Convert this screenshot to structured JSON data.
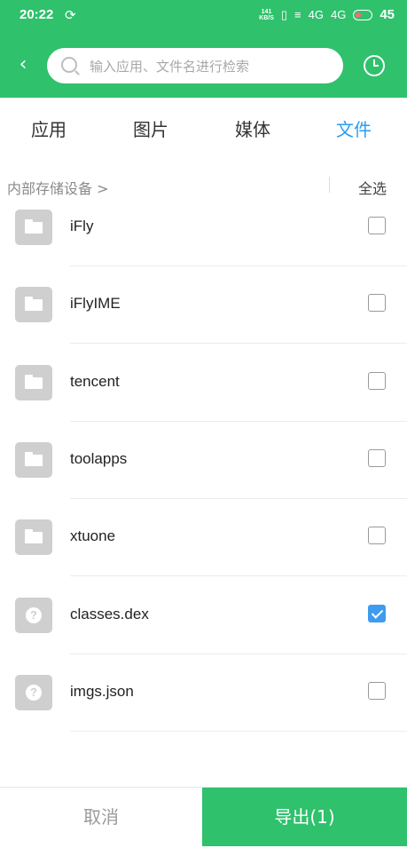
{
  "status_bar": {
    "time": "20:22",
    "net_speed_value": "141",
    "net_speed_unit": "KB/S",
    "signal_1": "4G",
    "signal_2": "4G",
    "battery": "45"
  },
  "search": {
    "placeholder": "输入应用、文件名进行检索"
  },
  "tabs": [
    {
      "label": "应用",
      "active": false
    },
    {
      "label": "图片",
      "active": false
    },
    {
      "label": "媒体",
      "active": false
    },
    {
      "label": "文件",
      "active": true
    }
  ],
  "breadcrumb": {
    "path": "内部存储设备  >",
    "select_all": "全选"
  },
  "files": [
    {
      "name": "iFly",
      "type": "folder",
      "checked": false
    },
    {
      "name": "iFlyIME",
      "type": "folder",
      "checked": false
    },
    {
      "name": "tencent",
      "type": "folder",
      "checked": false
    },
    {
      "name": "toolapps",
      "type": "folder",
      "checked": false
    },
    {
      "name": "xtuone",
      "type": "folder",
      "checked": false
    },
    {
      "name": "classes.dex",
      "type": "unknown",
      "checked": true
    },
    {
      "name": "imgs.json",
      "type": "unknown",
      "checked": false
    }
  ],
  "bottom": {
    "cancel": "取消",
    "export": "导出(1)"
  },
  "colors": {
    "primary": "#2fc16c",
    "accent": "#2a9df4",
    "checkbox_checked": "#3f9bf0"
  }
}
